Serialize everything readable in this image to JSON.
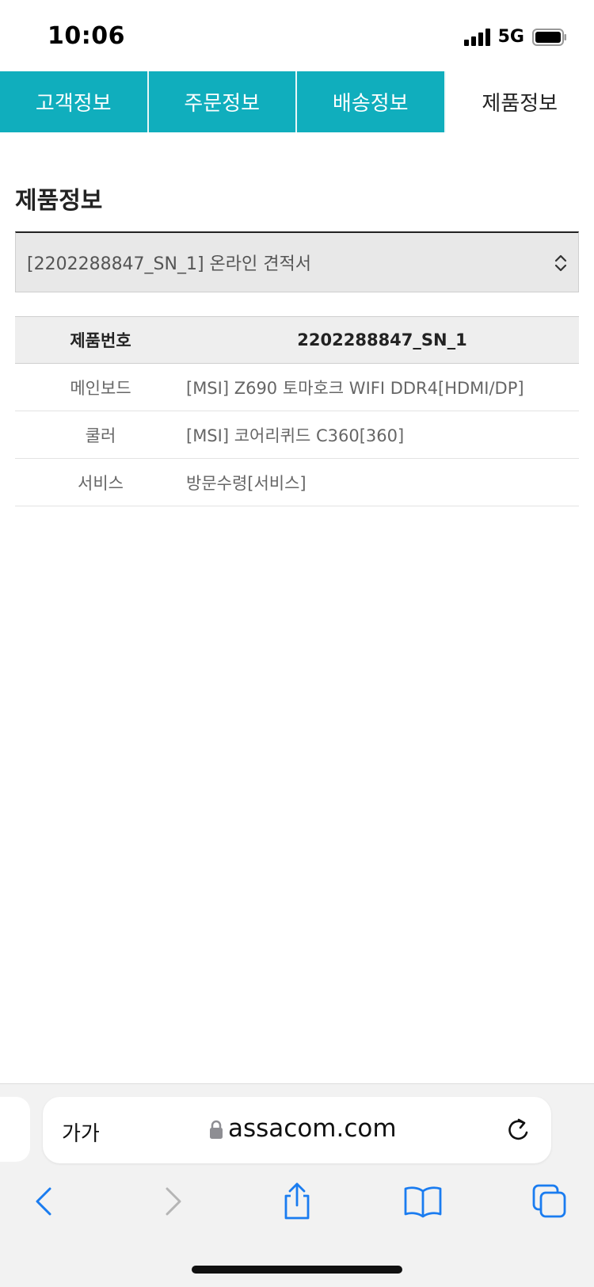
{
  "status": {
    "time": "10:06",
    "network": "5G"
  },
  "tabs": [
    {
      "label": "고객정보",
      "active": false
    },
    {
      "label": "주문정보",
      "active": false
    },
    {
      "label": "배송정보",
      "active": false
    },
    {
      "label": "제품정보",
      "active": true
    }
  ],
  "section": {
    "title": "제품정보",
    "select_value": "[2202288847_SN_1] 온라인 견적서"
  },
  "table": {
    "header": {
      "label": "제품번호",
      "value": "2202288847_SN_1"
    },
    "rows": [
      {
        "label": "메인보드",
        "value": "[MSI] Z690 토마호크 WIFI DDR4[HDMI/DP]"
      },
      {
        "label": "쿨러",
        "value": "[MSI] 코어리퀴드 C360[360]"
      },
      {
        "label": "서비스",
        "value": "방문수령[서비스]"
      }
    ]
  },
  "browser": {
    "aa_label": "가가",
    "url": "assacom.com"
  },
  "colors": {
    "tab_accent": "#10aebd",
    "link_blue": "#1a7cf0"
  }
}
